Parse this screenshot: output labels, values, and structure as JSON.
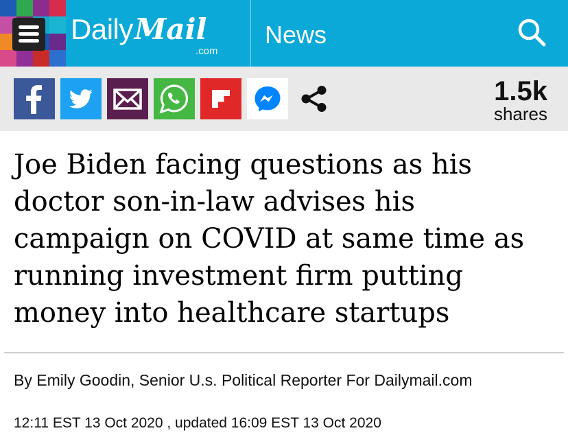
{
  "header": {
    "brand_daily": "Daily",
    "brand_mail": "Mail",
    "brand_dotcom": ".com",
    "section": "News",
    "background": "#0aa9d8"
  },
  "share": {
    "buttons": [
      {
        "name": "facebook",
        "icon": "facebook-icon",
        "color": "#3b5998"
      },
      {
        "name": "twitter",
        "icon": "twitter-icon",
        "color": "#1da1f2"
      },
      {
        "name": "email",
        "icon": "email-icon",
        "color": "#5b1f4f"
      },
      {
        "name": "whatsapp",
        "icon": "whatsapp-icon",
        "color": "#45b843"
      },
      {
        "name": "flipboard",
        "icon": "flipboard-icon",
        "color": "#e12828"
      },
      {
        "name": "messenger",
        "icon": "messenger-icon",
        "color": "#0084ff"
      },
      {
        "name": "share",
        "icon": "share-icon",
        "color": "#111111"
      }
    ],
    "count": "1.5k",
    "count_label": "shares"
  },
  "article": {
    "headline": "Joe Biden facing questions as his doctor son-in-law advises his campaign on COVID at same time as running investment firm putting money into healthcare startups",
    "byline": "By Emily Goodin, Senior U.s. Political Reporter For Dailymail.com",
    "published": "12:11 EST 13 Oct 2020",
    "updated": " , updated 16:09 EST 13 Oct 2020"
  }
}
